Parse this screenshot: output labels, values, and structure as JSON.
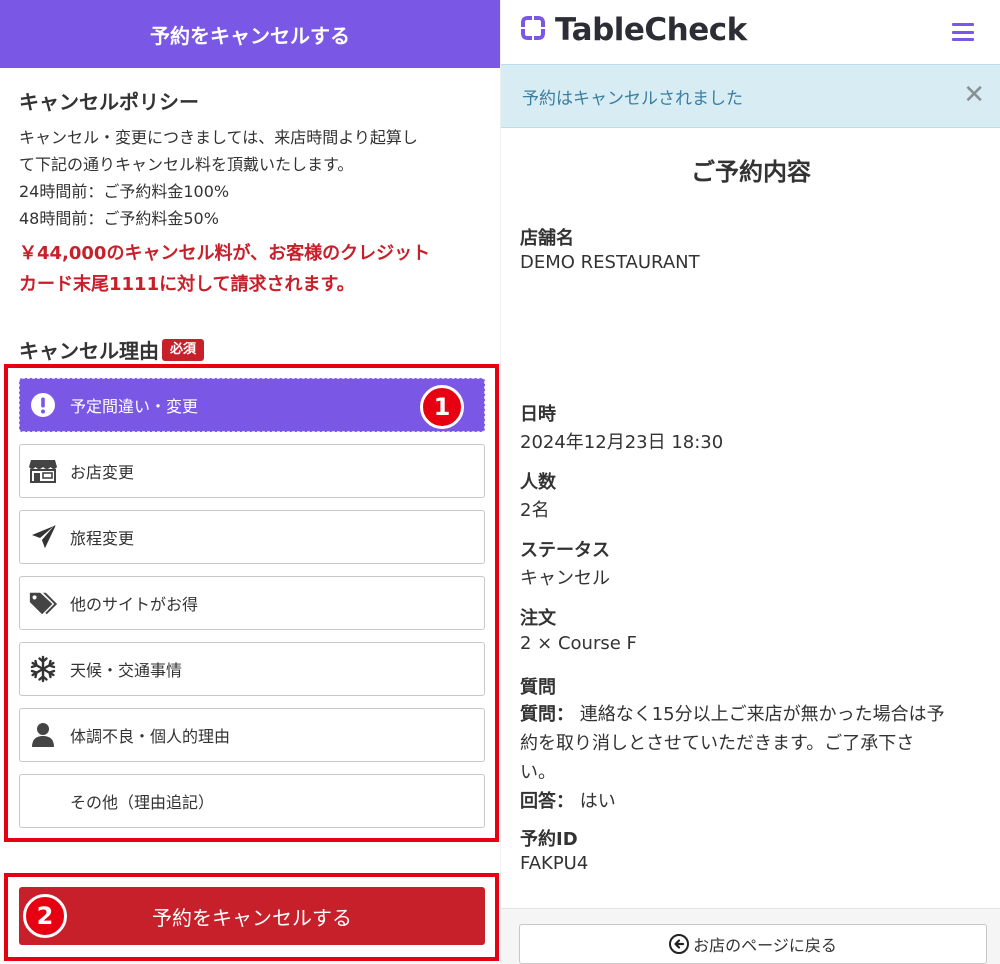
{
  "left": {
    "header_title": "予約をキャンセルする",
    "policy_title": "キャンセルポリシー",
    "policy_lines": [
      "キャンセル・変更につきましては、来店時間より起算し",
      "て下記の通りキャンセル料を頂戴いたします。",
      "24時間前：ご予約料金100%",
      "48時間前：ご予約料金50%"
    ],
    "warning_lines": [
      "￥44,000のキャンセル料が、お客様のクレジット",
      "カード末尾1111に対して請求されます。"
    ],
    "reason_title": "キャンセル理由",
    "required_badge": "必須",
    "reasons": [
      {
        "label": "予定間違い・変更",
        "icon": "exclamation-circle-icon",
        "selected": true
      },
      {
        "label": "お店変更",
        "icon": "store-icon",
        "selected": false
      },
      {
        "label": "旅程変更",
        "icon": "airplane-icon",
        "selected": false
      },
      {
        "label": "他のサイトがお得",
        "icon": "tags-icon",
        "selected": false
      },
      {
        "label": "天候・交通事情",
        "icon": "snowflake-icon",
        "selected": false
      },
      {
        "label": "体調不良・個人的理由",
        "icon": "user-icon",
        "selected": false
      },
      {
        "label": "その他（理由追記）",
        "icon": "",
        "selected": false
      }
    ],
    "marker_1": "1",
    "marker_2": "2",
    "cancel_button": "予約をキャンセルする",
    "accent_color": "#7b57e6",
    "danger_color": "#c8202b",
    "highlight_color": "#e60012"
  },
  "right": {
    "brand": "TableCheck",
    "alert_text": "予約はキャンセルされました",
    "alert_close": "✕",
    "booking_title": "ご予約内容",
    "fields": {
      "store_label": "店舗名",
      "store_value": "DEMO RESTAURANT",
      "date_label": "日時",
      "date_value": "2024年12月23日 18:30",
      "people_label": "人数",
      "people_value": "2名",
      "status_label": "ステータス",
      "status_value": "キャンセル",
      "order_label": "注文",
      "order_value": "2 × Course F",
      "question_label": "質問",
      "question_key": "質問：",
      "question_text_lines": [
        "連絡なく15分以上ご来店が無かった場合は予",
        "約を取り消しとさせていただきます。ご了承下さ",
        "い。"
      ],
      "answer_key": "回答：",
      "answer_value": "はい",
      "id_label": "予約ID",
      "id_value": "FAKPU4"
    },
    "back_button": "お店のページに戻る",
    "alert_bg_color": "#d8ecf4"
  }
}
